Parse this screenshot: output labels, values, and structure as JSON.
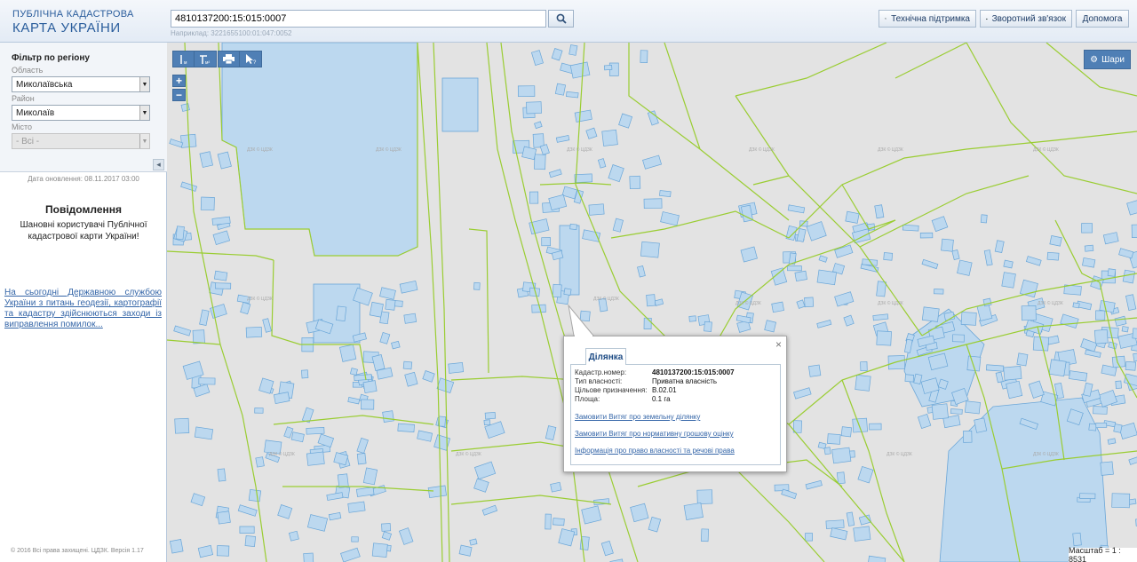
{
  "header": {
    "logo_line1": "ПУБЛІЧНА КАДАСТРОВА",
    "logo_line2": "КАРТА УКРАЇНИ",
    "search_value": "4810137200:15:015:0007",
    "search_hint": "Наприклад: 3221655100:01:047:0052",
    "buttons": [
      {
        "label": "Технічна підтримка",
        "icon": "tools-icon"
      },
      {
        "label": "Зворотний зв'язок",
        "icon": "envelope-icon"
      },
      {
        "label": "Допомога",
        "icon": ""
      }
    ]
  },
  "sidebar": {
    "filter_title": "Фільтр по регіону",
    "region_label": "Область",
    "region_value": "Миколаївська",
    "district_label": "Район",
    "district_value": "Миколаїв",
    "city_label": "Місто",
    "city_value": "- Всі -",
    "update_date": "Дата оновлення: 08.11.2017 03:00",
    "notice_title": "Повідомлення",
    "notice_body": "Шановні користувачі Публічної кадастрової карти України!",
    "notice_link": "На сьогодні Державною службою України з питань геодезії, картографії та кадастру здійснюються заходи із виправлення помилок...",
    "footer": "© 2016 Всі права захищені. ЦДЗК. Версія 1.17"
  },
  "map": {
    "layers_label": "Шари",
    "scale_label": "Масштаб = 1 : 8531",
    "zoom_in": "+",
    "zoom_out": "−",
    "watermark": "ДЗК © ЦДЗК",
    "colors": {
      "parcel_stroke": "#9acd32",
      "parcel_fill": "#bcd8ef",
      "building_stroke": "#6aa6d8",
      "background": "#e3e3e3",
      "toolbar": "#4f7fb5"
    }
  },
  "popup": {
    "tab": "Ділянка",
    "rows": [
      {
        "label": "Кадастр.номер:",
        "value": "4810137200:15:015:0007"
      },
      {
        "label": "Тип власності:",
        "value": "Приватна власність"
      },
      {
        "label": "Цільове призначення:",
        "value": "В.02.01"
      },
      {
        "label": "Площа:",
        "value": "0.1 га"
      }
    ],
    "links": [
      "Замовити Витяг про земельну ділянку",
      "Замовити Витяг про нормативну грошову оцінку",
      "Інформація про право власності та речові права"
    ],
    "close": "×"
  }
}
